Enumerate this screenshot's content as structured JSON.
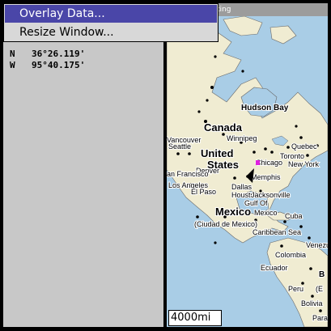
{
  "menu": {
    "items": [
      {
        "label": "Overlay Data...",
        "selected": true
      },
      {
        "label": "Resize Window...",
        "selected": false
      }
    ]
  },
  "map_title": "ting",
  "position": {
    "lat_dir": "N",
    "lat": "36°26.119'",
    "lon_dir": "W",
    "lon": "95°40.175'"
  },
  "map": {
    "labels": {
      "hudson_bay": "Hudson Bay",
      "canada": "Canada",
      "vancouver": "Vancouver",
      "winnipeg": "Winnipeg",
      "seattle": "Seattle",
      "quebec": "Quebec",
      "united": "United",
      "states": "States",
      "toronto": "Toronto",
      "chicago": "Chicago",
      "new_york": "New York",
      "denver": "Denver",
      "san_francisco": "an Francisco",
      "memphis": "Memphis",
      "los_angeles": "Los Angeles",
      "dallas": "Dallas",
      "el_paso": "El Paso",
      "houston": "Houston",
      "jacksonville": "Jacksonville",
      "gulf_of": "Gulf Of",
      "mexico_country": "Mexico",
      "mexico_city_label": "Mexico",
      "cuba": "Cuba",
      "ciudad": "(Ciudad de Mexico)",
      "caribbean": "Caribbean Sea",
      "venezuela": "Venezue",
      "colombia": "Colombia",
      "ecuador": "Ecuador",
      "peru": "Peru",
      "brazil": "B",
      "bolivia": "Bolivia",
      "paraguay": "Para",
      "b_paren": "(E"
    },
    "scale": "4000mi",
    "colors": {
      "water": "#a9cde6",
      "land": "#f0ecd2",
      "cursor": "#000000",
      "marker": "#e020e0"
    }
  }
}
